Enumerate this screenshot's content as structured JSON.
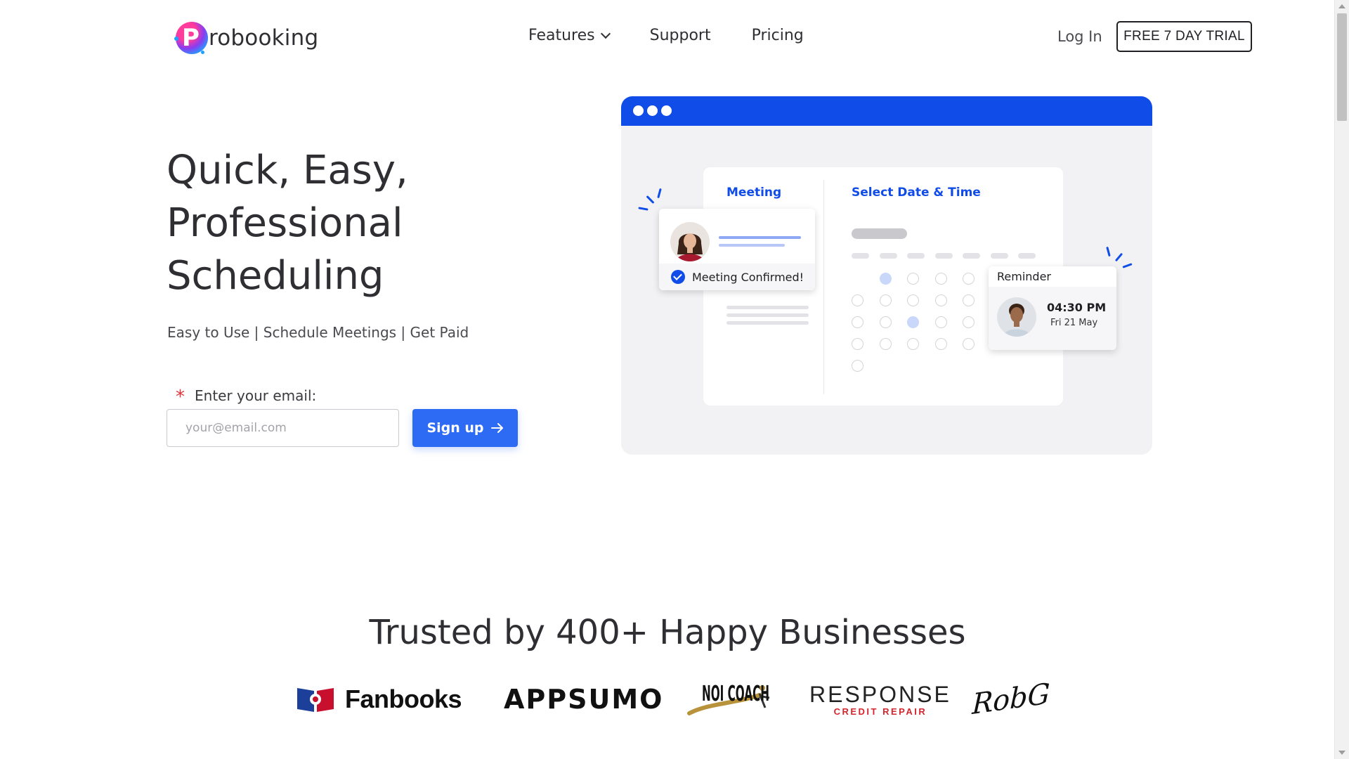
{
  "header": {
    "logo_text": "robooking",
    "logo_letter": "P",
    "nav": [
      {
        "label": "Features"
      },
      {
        "label": "Support"
      },
      {
        "label": "Pricing"
      }
    ],
    "login_label": "Log In",
    "trial_label": "FREE 7 DAY TRIAL"
  },
  "hero": {
    "title_lines": [
      "Quick, Easy,",
      "Professional",
      "Scheduling"
    ],
    "subtitle": "Easy to Use | Schedule Meetings | Get Paid",
    "email_label": "Enter your email:",
    "email_placeholder": "your@email.com",
    "signup_label": "Sign up"
  },
  "illustration": {
    "meeting_label": "Meeting",
    "select_label": "Select Date & Time",
    "confirmed_text": "Meeting Confirmed!",
    "reminder_label": "Reminder",
    "reminder_time": "04:30 PM",
    "reminder_date": "Fri 21 May"
  },
  "trusted": {
    "heading": "Trusted by 400+ Happy Businesses",
    "logos": [
      {
        "name": "Fanbooks"
      },
      {
        "name": "APPSUMO"
      },
      {
        "name": "NOI COACH"
      },
      {
        "name": "RESPONSE",
        "sub": "CREDIT REPAIR"
      },
      {
        "name": "RobG"
      }
    ]
  },
  "colors": {
    "accent": "#2e6bf5",
    "brand_blue": "#0f4ce8",
    "text": "#2f2f33"
  }
}
